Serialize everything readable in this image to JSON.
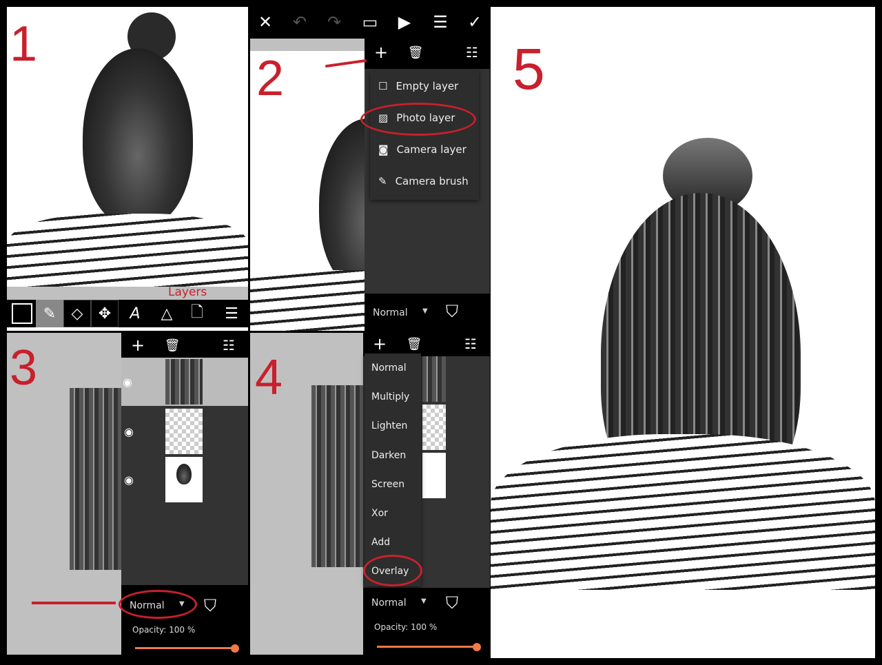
{
  "steps": {
    "s1": "1",
    "s2": "2",
    "s3": "3",
    "s4": "4",
    "s5": "5"
  },
  "panel1": {
    "annotation": "Layers",
    "tools": [
      "color-swatch",
      "brush",
      "eraser",
      "move",
      "text",
      "shapes",
      "add-image",
      "layers"
    ]
  },
  "panel2": {
    "top_toolbar": [
      "close",
      "undo",
      "redo",
      "crop",
      "preview",
      "menu",
      "done"
    ],
    "layer_toolbar": [
      "add",
      "delete",
      "list"
    ],
    "add_menu": [
      {
        "icon": "square-icon",
        "label": "Empty layer"
      },
      {
        "icon": "image-icon",
        "label": "Photo layer"
      },
      {
        "icon": "camera-icon",
        "label": "Camera layer"
      },
      {
        "icon": "brush-icon",
        "label": "Camera brush"
      }
    ],
    "blend_mode": "Normal"
  },
  "panel3": {
    "blend_mode": "Normal",
    "opacity_label": "Opacity: 100 %",
    "opacity": 100
  },
  "panel4": {
    "blend_modes": [
      "Normal",
      "Multiply",
      "Lighten",
      "Darken",
      "Screen",
      "Xor",
      "Add",
      "Overlay"
    ],
    "selected": "Overlay",
    "blend_mode": "Normal",
    "opacity_label": "Opacity: 100 %",
    "opacity": 100
  },
  "colors": {
    "accent": "#c8202c",
    "slider": "#f07a4a"
  }
}
